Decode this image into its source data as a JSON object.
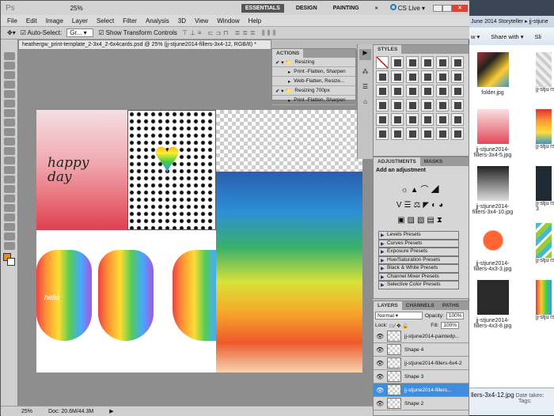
{
  "appbar": {
    "logo": "Ps",
    "zoom": "25%",
    "workspaces": [
      "ESSENTIALS",
      "DESIGN",
      "PAINTING",
      "»"
    ],
    "cs_live": "CS Live ▾"
  },
  "menu": [
    "File",
    "Edit",
    "Image",
    "Layer",
    "Select",
    "Filter",
    "Analysis",
    "3D",
    "View",
    "Window",
    "Help"
  ],
  "options": {
    "auto_select_label": "Auto-Select:",
    "auto_select_value": "Gr...",
    "show_transform": "Show Transform Controls"
  },
  "document": {
    "tab_title": "heathergw_print-template_2-3x4_2-6x4cards.psd @ 25% (jj-stjune2014-fillers-3x4-12, RGB/8) *",
    "canvas_text": "happy day",
    "hand_text": "hello"
  },
  "status": {
    "zoom": "25%",
    "doc": "Doc: 20.6M/44.3M"
  },
  "actions": {
    "title": "ACTIONS",
    "rows": [
      "Resizing",
      "Print -Flatten, Sharpen",
      "Web-Flatten, Resize...",
      "Resizing 700px",
      "Print -Flatten, Sharpen"
    ]
  },
  "styles": {
    "title": "STYLES"
  },
  "adjustments": {
    "tabs": [
      "ADJUSTMENTS",
      "MASKS"
    ],
    "heading": "Add an adjustment",
    "presets": [
      "Levels Presets",
      "Curves Presets",
      "Exposure Presets",
      "Hue/Saturation Presets",
      "Black & White Presets",
      "Channel Mixer Presets",
      "Selective Color Presets"
    ]
  },
  "layers": {
    "tabs": [
      "LAYERS",
      "CHANNELS",
      "PATHS"
    ],
    "blend": "Normal",
    "opacity_label": "Opacity:",
    "opacity": "100%",
    "lock_label": "Lock:",
    "fill_label": "Fill:",
    "fill": "100%",
    "items": [
      "jj-stjune2014-paintedp...",
      "Shape 4",
      "jj-stjune2014-fillers-6x4-2",
      "Shape 3",
      "jj-stjune2014-fillers...",
      "Shape 2"
    ],
    "selected": 4
  },
  "explorer": {
    "breadcrumb": "June 2014 Storyteller ▸ jj-stjune",
    "toolbar": [
      "w ▾",
      "Share with ▾",
      "Sli"
    ],
    "files": [
      "folder.jpg",
      "jj-stjune2014-fillers-3x4-5.jpg",
      "jj-stjune2014-fillers-3x4-10.jpg",
      "jj-stjune2014-fillers-4x3-3.jpg",
      "jj-stjune2014-fillers-4x3-8.jpg"
    ],
    "files_right": [
      "jj-stju rs-",
      "jj-stju rs-",
      "jj-stju rs-3",
      "jj-stju rs-",
      "jj-stju rs-"
    ],
    "details_name": "llers-3x4-12.jpg",
    "details_date": "Date taken:",
    "details_tags": "Tags:"
  }
}
